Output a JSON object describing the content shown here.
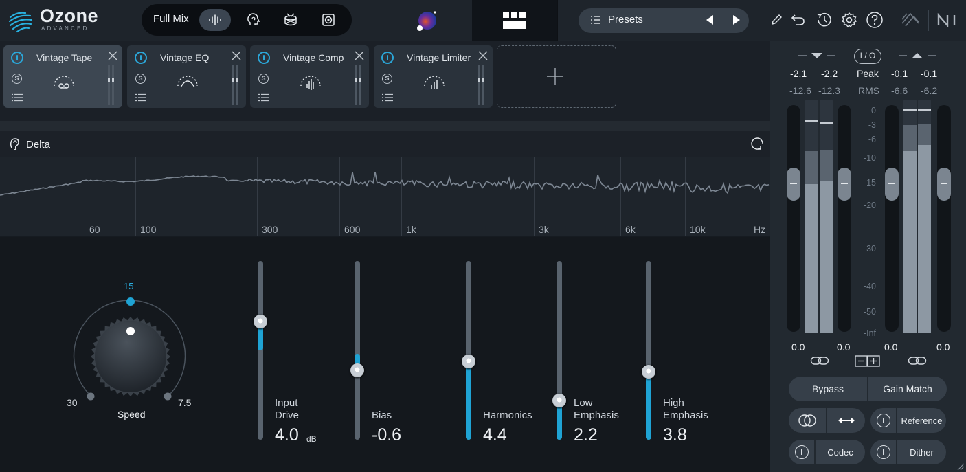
{
  "brand": {
    "name": "Ozone",
    "edition": "ADVANCED"
  },
  "toolbar": {
    "mode_label": "Full Mix",
    "presets_label": "Presets"
  },
  "modules": [
    {
      "title": "Vintage Tape",
      "active": true
    },
    {
      "title": "Vintage EQ",
      "active": false
    },
    {
      "title": "Vintage Comp",
      "active": false
    },
    {
      "title": "Vintage Limiter",
      "active": false
    }
  ],
  "spectrum": {
    "delta_label": "Delta",
    "freq_labels": [
      "60",
      "100",
      "300",
      "600",
      "1k",
      "3k",
      "6k",
      "10k",
      "Hz"
    ]
  },
  "speed_knob": {
    "label": "Speed",
    "value": "15",
    "min_label": "30",
    "max_label": "7.5"
  },
  "sliders": [
    {
      "label_line1": "Input",
      "label_line2": "Drive",
      "value": "4.0",
      "unit": "dB",
      "level": 0.66,
      "fill_from": 0.5
    },
    {
      "label_line1": "",
      "label_line2": "Bias",
      "value": "-0.6",
      "unit": "",
      "level": 0.39,
      "fill_from": 0.48
    },
    {
      "label_line1": "",
      "label_line2": "Harmonics",
      "value": "4.4",
      "unit": "",
      "level": 0.44,
      "fill_from": 0.0
    },
    {
      "label_line1": "Low",
      "label_line2": "Emphasis",
      "value": "2.2",
      "unit": "",
      "level": 0.22,
      "fill_from": 0.0
    },
    {
      "label_line1": "High",
      "label_line2": "Emphasis",
      "value": "3.8",
      "unit": "",
      "level": 0.38,
      "fill_from": 0.0
    }
  ],
  "meters": {
    "input": {
      "peak_l": "-2.1",
      "peak_r": "-2.2",
      "rms_l": "-12.6",
      "rms_r": "-12.3",
      "gain": "0.0"
    },
    "output": {
      "peak_l": "-0.1",
      "peak_r": "-0.1",
      "rms_l": "-6.6",
      "rms_r": "-6.2",
      "gain": "0.0"
    },
    "io_label": "I / O",
    "peak_label": "Peak",
    "rms_label": "RMS",
    "input_gain_right": "0.0",
    "output_gain_left": "0.0",
    "scale": [
      "0",
      "-3",
      "-6",
      "-10",
      "-15",
      "-20",
      "-30",
      "-40",
      "-50",
      "-Inf"
    ]
  },
  "bottom_buttons": {
    "bypass": "Bypass",
    "gain_match": "Gain Match",
    "reference": "Reference",
    "codec": "Codec",
    "dither": "Dither"
  },
  "colors": {
    "accent": "#1fa3d4",
    "background": "#161b21"
  }
}
